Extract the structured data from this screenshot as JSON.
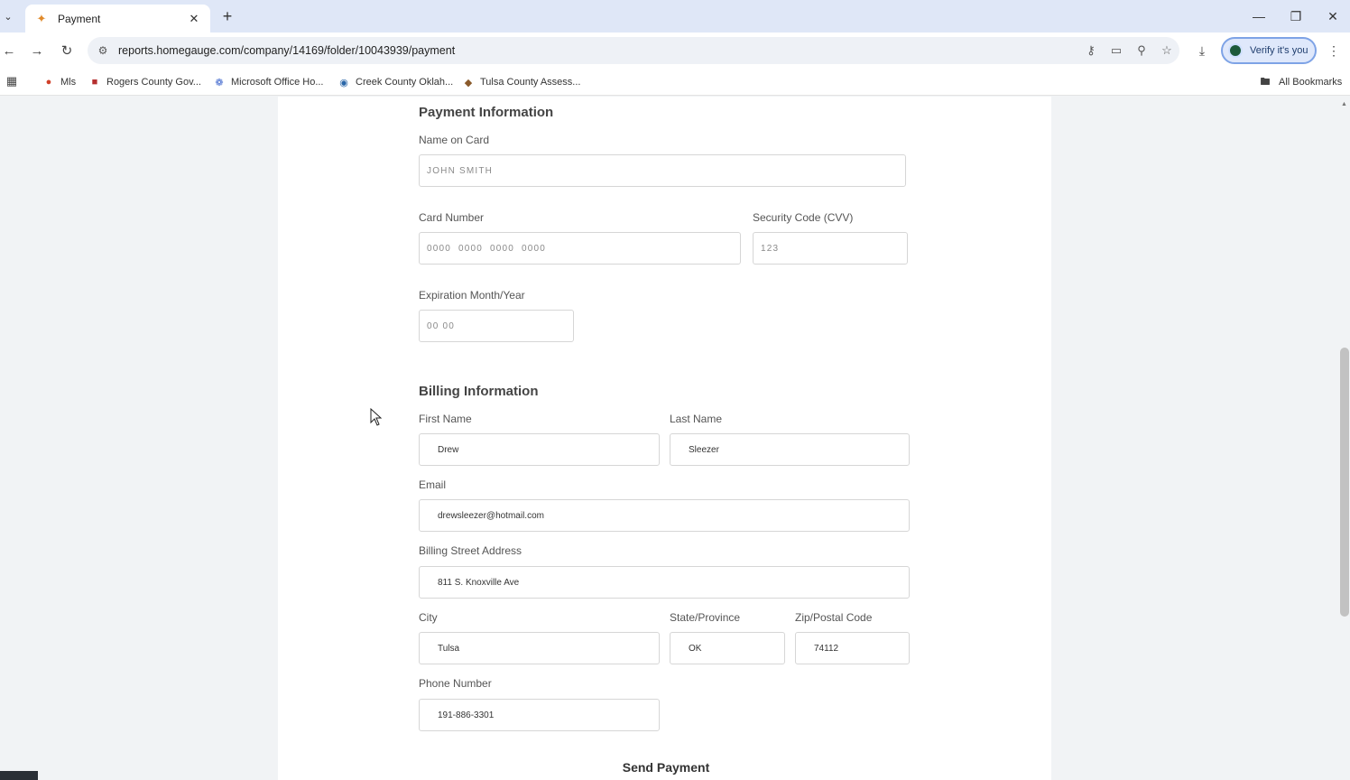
{
  "browser": {
    "tab_title": "Payment",
    "url": "reports.homegauge.com/company/14169/folder/10043939/payment",
    "verify_label": "Verify it's you",
    "bookmarks": [
      {
        "label": "Mls",
        "icon": "c-logo-icon"
      },
      {
        "label": "Rogers County Gov...",
        "icon": "county-seal-icon"
      },
      {
        "label": "Microsoft Office Ho...",
        "icon": "office-icon"
      },
      {
        "label": "Creek County Oklah...",
        "icon": "globe-icon"
      },
      {
        "label": "Tulsa County Assess...",
        "icon": "diamond-icon"
      }
    ],
    "all_bookmarks_label": "All Bookmarks"
  },
  "payment": {
    "title": "Payment Information",
    "name_on_card_label": "Name on Card",
    "name_on_card_placeholder": "JOHN SMITH",
    "card_number_label": "Card Number",
    "card_number_placeholder": "0000  0000  0000  0000",
    "cvv_label": "Security Code (CVV)",
    "cvv_placeholder": "123",
    "expiration_label": "Expiration Month/Year",
    "expiration_placeholder": "00 00"
  },
  "billing": {
    "title": "Billing Information",
    "first_name_label": "First Name",
    "first_name_value": "Drew",
    "last_name_label": "Last Name",
    "last_name_value": "Sleezer",
    "email_label": "Email",
    "email_value": "drewsleezer@hotmail.com",
    "street_label": "Billing Street Address",
    "street_value": "811 S. Knoxville Ave",
    "city_label": "City",
    "city_value": "Tulsa",
    "state_label": "State/Province",
    "state_value": "OK",
    "zip_label": "Zip/Postal Code",
    "zip_value": "74112",
    "phone_label": "Phone Number",
    "phone_value": "191-886-3301"
  },
  "send_button_label": "Send Payment",
  "colors": {
    "tab_strip": "#dfe7f7",
    "page_background": "#f1f3f5",
    "card_background": "#ffffff",
    "verify_accent": "#7ea3e6"
  }
}
